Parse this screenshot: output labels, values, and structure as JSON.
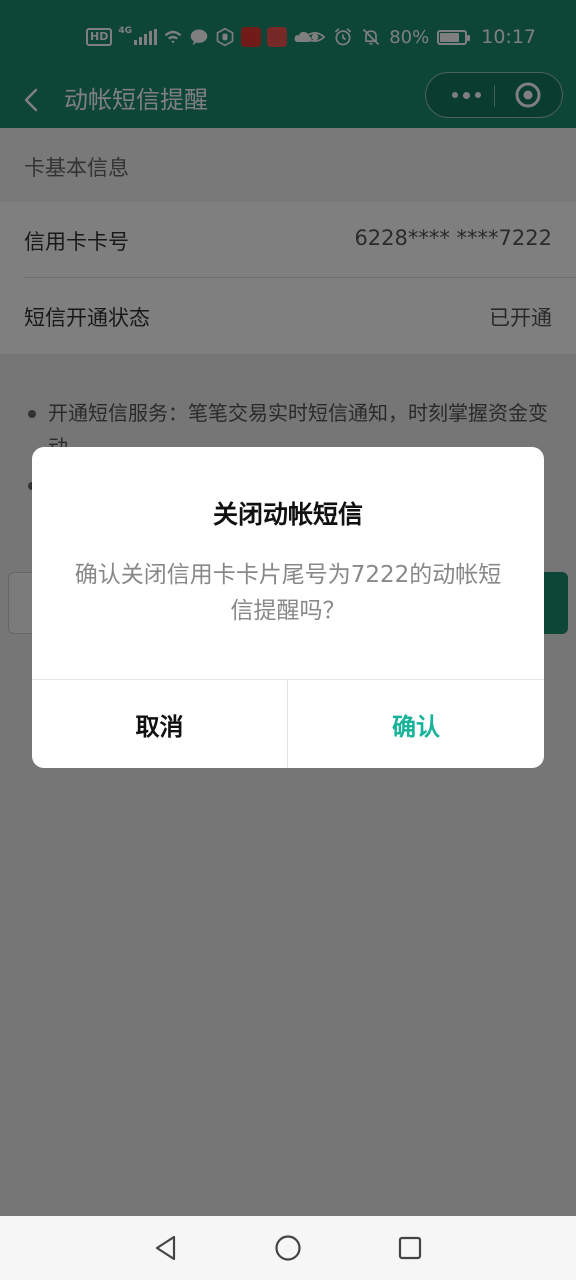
{
  "status_bar": {
    "hd": "HD",
    "network": "4G",
    "battery": "80%",
    "battery_level": 0.8,
    "time": "10:17",
    "app_icon_colors": [
      "#e53935",
      "#ef5350"
    ]
  },
  "nav": {
    "title": "动帐短信提醒"
  },
  "page": {
    "section_title": "卡基本信息",
    "rows": [
      {
        "label": "信用卡卡号",
        "value": "6228**** ****7222"
      },
      {
        "label": "短信开通状态",
        "value": "已开通"
      }
    ],
    "notes": [
      "开通短信服务：笔笔交易实时短信通知，时刻掌握资金变动"
    ]
  },
  "dialog": {
    "title": "关闭动帐短信",
    "message": "确认关闭信用卡卡片尾号为7222的动帐短信提醒吗？",
    "cancel": "取消",
    "confirm": "确认"
  },
  "colors": {
    "brand": "#1a8a6e",
    "confirm": "#16b39a"
  }
}
